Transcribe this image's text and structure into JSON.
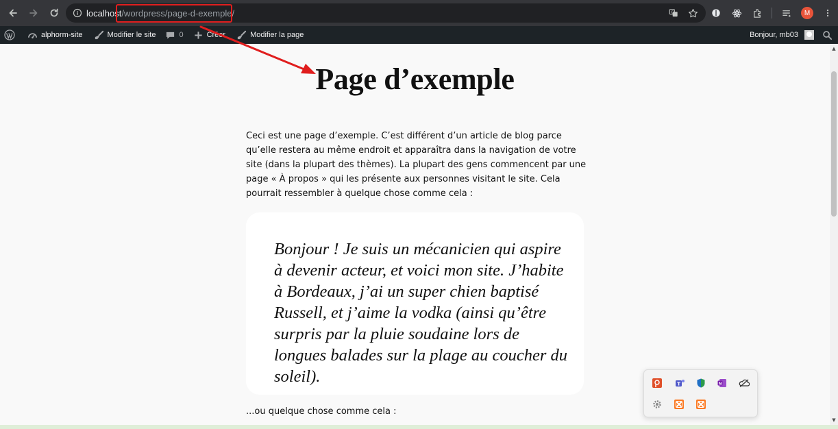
{
  "browser": {
    "url_host": "localhost",
    "url_path": "/wordpress/page-d-exemple/",
    "avatar_letter": "M"
  },
  "adminbar": {
    "site_name": "alphorm-site",
    "edit_site": "Modifier le site",
    "comments_count": "0",
    "new_label": "Créer",
    "edit_page": "Modifier la page",
    "greeting": "Bonjour, mb03"
  },
  "page": {
    "title": "Page d’exemple",
    "intro": "Ceci est une page d’exemple. C’est différent d’un article de blog parce qu’elle restera au même endroit et apparaîtra dans la navigation de votre site (dans la plupart des thèmes). La plupart des gens commencent par une page « À propos » qui les présente aux personnes visitant le site. Cela pourrait ressembler à quelque chose comme cela :",
    "quote": "Bonjour ! Je suis un mécanicien qui aspire à devenir acteur, et voici mon site. J’habite à Bordeaux, j’ai un super chien baptisé Russell, et j’aime la vodka (ainsi qu’être surpris par la pluie soudaine lors de longues balades sur la plage au coucher du soleil).",
    "outro": "...ou quelque chose comme cela :"
  },
  "annotation": {
    "highlight_color": "#e01e1e"
  },
  "tray": {
    "icons": [
      "presentation-app-icon",
      "teams-icon",
      "defender-icon",
      "onenote-icon",
      "onedrive-icon",
      "settings-gear-icon",
      "xampp-icon",
      "xampp-icon"
    ]
  }
}
